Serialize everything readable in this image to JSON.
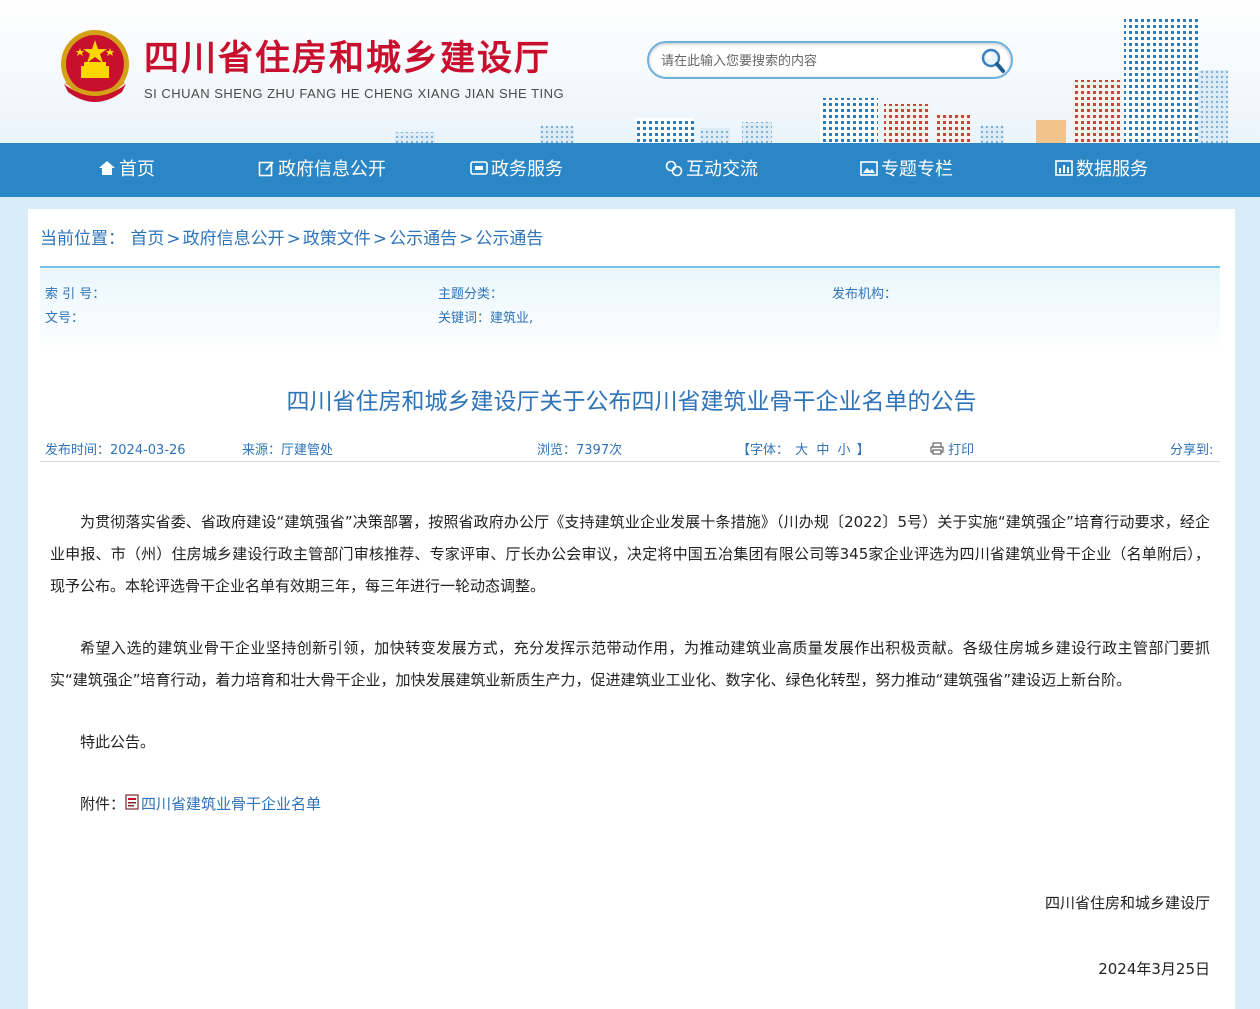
{
  "header": {
    "site_title": "四川省住房和城乡建设厅",
    "site_subtitle": "SI CHUAN SHENG ZHU FANG HE CHENG XIANG JIAN SHE TING",
    "search_placeholder": "请在此输入您要搜索的内容"
  },
  "nav": [
    {
      "label": "首页",
      "icon": "home-icon"
    },
    {
      "label": "政府信息公开",
      "icon": "edit-icon"
    },
    {
      "label": "政务服务",
      "icon": "service-icon"
    },
    {
      "label": "互动交流",
      "icon": "interact-icon"
    },
    {
      "label": "专题专栏",
      "icon": "image-icon"
    },
    {
      "label": "数据服务",
      "icon": "data-icon"
    }
  ],
  "breadcrumb": {
    "prefix": "当前位置：",
    "items": [
      "首页",
      "政府信息公开",
      "政策文件",
      "公示通告",
      "公示通告"
    ],
    "separator": ">"
  },
  "meta": {
    "index_label": "索 引 号：",
    "topic_label": "主题分类：",
    "publisher_label": "发布机构：",
    "docno_label": "文号：",
    "keywords": "关键词：建筑业,"
  },
  "article": {
    "title": "四川省住房和城乡建设厅关于公布四川省建筑业骨干企业名单的公告",
    "publish_time": "发布时间：2024-03-26",
    "source": "来源：厅建管处",
    "views": "浏览：7397次",
    "font_label": "【字体：",
    "font_large": "大",
    "font_medium": "中",
    "font_small": "小",
    "font_close": "】",
    "print": "打印",
    "share": "分享到:",
    "paragraphs": [
      "为贯彻落实省委、省政府建设“建筑强省”决策部署，按照省政府办公厅《支持建筑业企业发展十条措施》（川办规〔2022〕5号）关于实施“建筑强企”培育行动要求，经企业申报、市（州）住房城乡建设行政主管部门审核推荐、专家评审、厅长办公会审议，决定将中国五冶集团有限公司等345家企业评选为四川省建筑业骨干企业（名单附后），现予公布。本轮评选骨干企业名单有效期三年，每三年进行一轮动态调整。",
      "希望入选的建筑业骨干企业坚持创新引领，加快转变发展方式，充分发挥示范带动作用，为推动建筑业高质量发展作出积极贡献。各级住房城乡建设行政主管部门要抓实“建筑强企”培育行动，着力培育和壮大骨干企业，加快发展建筑业新质生产力，促进建筑业工业化、数字化、绿色化转型，努力推动“建筑强省”建设迈上新台阶。",
      "特此公告。"
    ],
    "attachment_label": "附件：",
    "attachment_link": "四川省建筑业骨干企业名单",
    "signature": "四川省住房和城乡建设厅",
    "date": "2024年3月25日"
  },
  "colors": {
    "brand_red": "#c8102e",
    "nav_blue": "#2b86c5",
    "link_blue": "#2f73b8"
  }
}
